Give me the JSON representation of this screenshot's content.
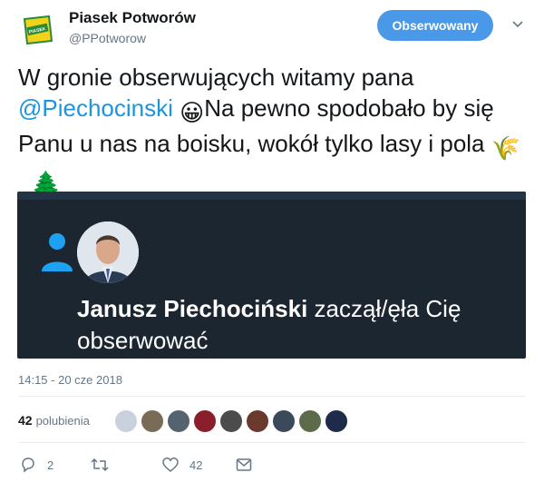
{
  "header": {
    "display_name": "Piasek Potworów",
    "handle": "@PPotworow",
    "follow_label": "Obserwowany",
    "logo_text": "PIASEK POTWORÓW"
  },
  "tweet": {
    "text_part1": "W gronie obserwujących witamy pana ",
    "mention": "@Piechocinski",
    "emoji1": "😀",
    "text_part2": "Na pewno spodobało by się Panu u nas na boisku, wokół tylko lasy i pola ",
    "emoji2": "🌾",
    "emoji3": "🌲"
  },
  "media": {
    "name": "Janusz Piechociński",
    "action_text": " zaczął/ęła Cię obserwować"
  },
  "meta": {
    "timestamp": "14:15 - 20 cze 2018",
    "likes_count": "42",
    "likes_label": "polubienia"
  },
  "actions": {
    "replies": "2",
    "retweets": "",
    "likes": "42"
  },
  "colors": {
    "accent": "#1b95e0",
    "follow_button": "#4a99e9",
    "media_bg": "#1c2631"
  }
}
